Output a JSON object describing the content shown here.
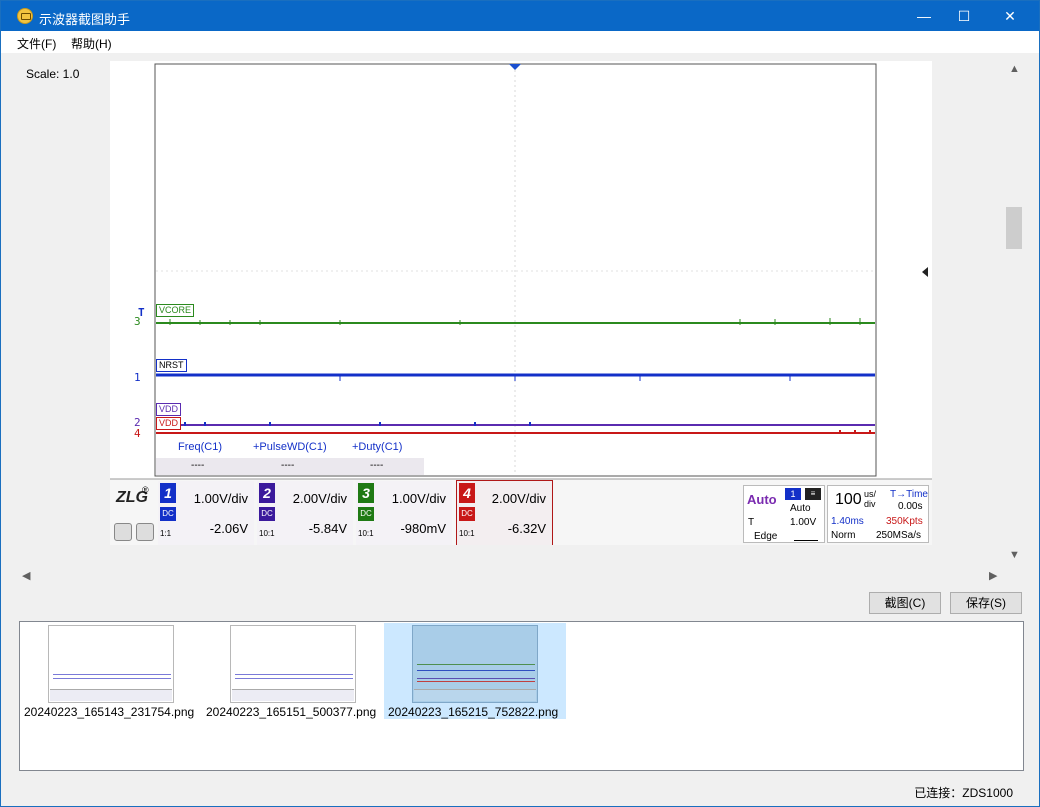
{
  "window": {
    "title": "示波器截图助手",
    "min": "—",
    "max": "☐",
    "close": "✕"
  },
  "menu": [
    {
      "label": "文件(F)"
    },
    {
      "label": "帮助(H)"
    }
  ],
  "scale_label": "Scale: 1.0",
  "scope": {
    "ch3_label": "VCORE",
    "ch1_label": "NRST",
    "ch2_label": "VDD",
    "ch4_label": "VDD",
    "marker_ch3": "3",
    "marker_ch1": "1",
    "marker_ch2": "2",
    "marker_ch4": "4",
    "trig_marker": "T",
    "measurements": [
      {
        "name": "Freq(C1)",
        "value": "----"
      },
      {
        "name": "+PulseWD(C1)",
        "value": "----"
      },
      {
        "name": "+Duty(C1)",
        "value": "----"
      }
    ],
    "logo": "ZLG",
    "channels": [
      {
        "num": "1",
        "volts_div": "1.00V/div",
        "offset": "-2.06V",
        "probe": "1:1",
        "color": "#1330c8"
      },
      {
        "num": "2",
        "volts_div": "2.00V/div",
        "offset": "-5.84V",
        "probe": "10:1",
        "color": "#3b1a9c"
      },
      {
        "num": "3",
        "volts_div": "1.00V/div",
        "offset": "-980mV",
        "probe": "10:1",
        "color": "#1f7a14"
      },
      {
        "num": "4",
        "volts_div": "2.00V/div",
        "offset": "-6.32V",
        "probe": "10:1",
        "color": "#c81818"
      }
    ],
    "trigger": {
      "mode": "Auto",
      "source": "1",
      "sweep": "Auto",
      "level_label": "T",
      "level": "1.00V",
      "type": "Edge"
    },
    "timebase": {
      "value": "100",
      "unit_top": "us/",
      "unit_bottom": "div",
      "delay_label": "T→Time",
      "delay": "0.00s",
      "window": "1.40ms",
      "memory": "350Kpts",
      "acq": "Norm",
      "rate": "250MSa/s"
    }
  },
  "buttons": {
    "capture": "截图(C)",
    "save": "保存(S)"
  },
  "thumbnails": [
    {
      "caption": "20240223_165143_231754.png",
      "selected": false
    },
    {
      "caption": "20240223_165151_500377.png",
      "selected": false
    },
    {
      "caption": "20240223_165215_752822.png",
      "selected": true
    }
  ],
  "status": "已连接：ZDS1000"
}
